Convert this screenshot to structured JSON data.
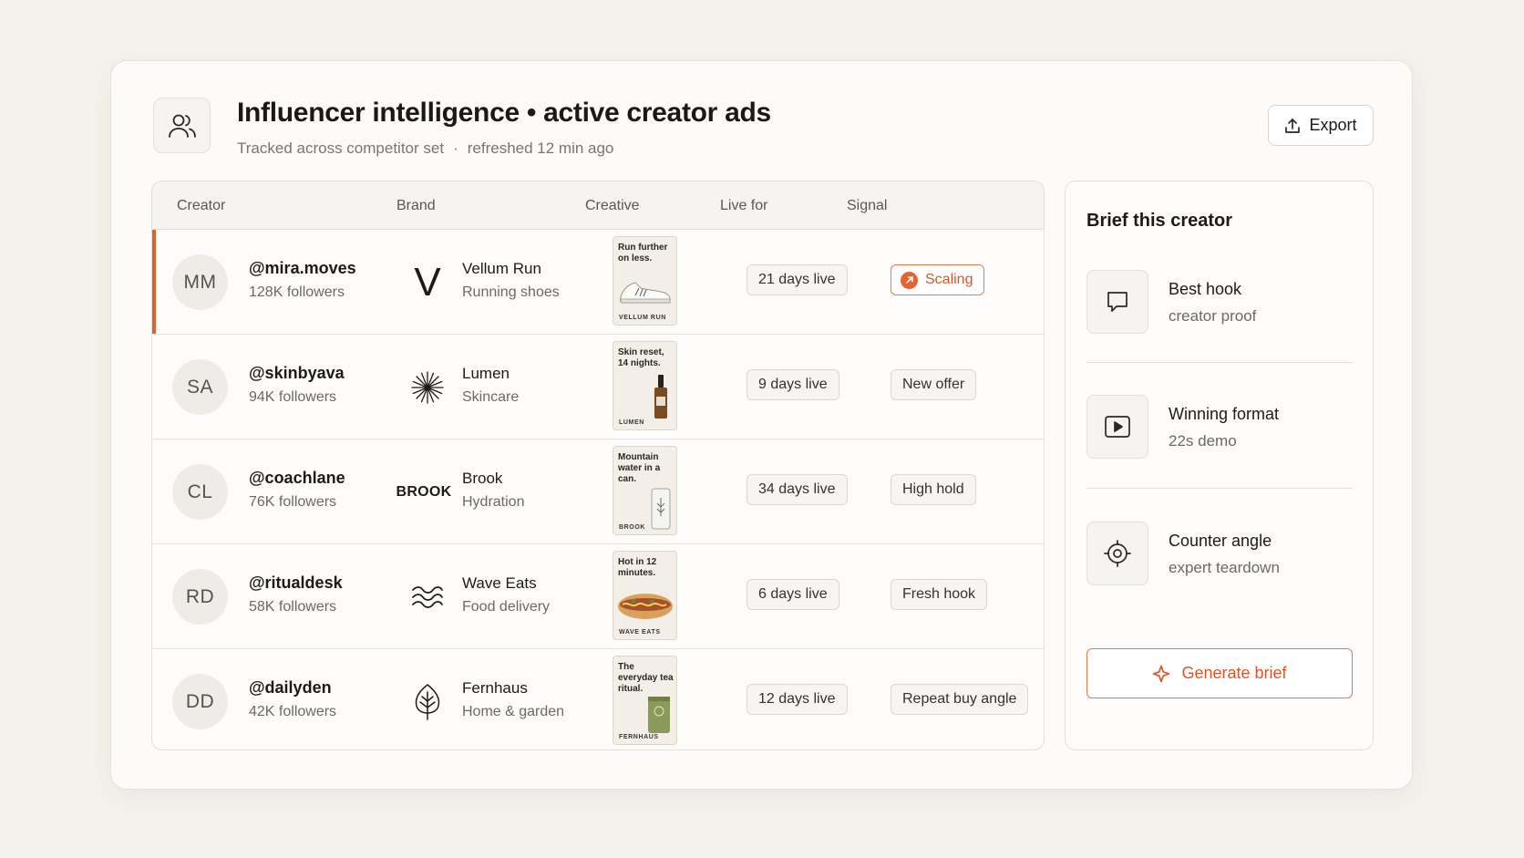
{
  "header": {
    "title": "Influencer intelligence • active creator ads",
    "subtitle_left": "Tracked across competitor set",
    "subtitle_sep": "·",
    "subtitle_right": "refreshed 12 min ago",
    "export_label": "Export",
    "icon": "users-icon"
  },
  "table": {
    "columns": [
      "Creator",
      "Brand",
      "Creative",
      "Live for",
      "Signal"
    ],
    "rows": [
      {
        "initials": "MM",
        "handle": "@mira.moves",
        "followers": "128K followers",
        "brand": "Vellum Run",
        "category": "Running shoes",
        "brand_logo_text": "V",
        "creative_text": "Run further on less.",
        "creative_footer": "VELLUM RUN",
        "live": "21 days live",
        "signal": "Scaling",
        "active": true
      },
      {
        "initials": "SA",
        "handle": "@skinbyava",
        "followers": "94K followers",
        "brand": "Lumen",
        "category": "Skincare",
        "brand_logo_text": "",
        "creative_text": "Skin reset, 14 nights.",
        "creative_footer": "LUMEN",
        "live": "9 days live",
        "signal": "New offer"
      },
      {
        "initials": "CL",
        "handle": "@coachlane",
        "followers": "76K followers",
        "brand": "Brook",
        "category": "Hydration",
        "brand_logo_text": "BROOK",
        "creative_text": "Mountain water in a can.",
        "creative_footer": "BROOK",
        "live": "34 days live",
        "signal": "High hold"
      },
      {
        "initials": "RD",
        "handle": "@ritualdesk",
        "followers": "58K followers",
        "brand": "Wave Eats",
        "category": "Food delivery",
        "brand_logo_text": "",
        "creative_text": "Hot in 12 minutes.",
        "creative_footer": "WAVE EATS",
        "live": "6 days live",
        "signal": "Fresh hook"
      },
      {
        "initials": "DD",
        "handle": "@dailyden",
        "followers": "42K followers",
        "brand": "Fernhaus",
        "category": "Home & garden",
        "brand_logo_text": "",
        "creative_text": "The everyday tea ritual.",
        "creative_footer": "FERNHAUS",
        "live": "12 days live",
        "signal": "Repeat buy angle"
      }
    ]
  },
  "brief": {
    "title": "Brief this creator",
    "items": [
      {
        "label": "Best hook",
        "value": "creator proof",
        "icon": "chat-bubble-icon"
      },
      {
        "label": "Winning format",
        "value": "22s demo",
        "icon": "play-icon"
      },
      {
        "label": "Counter angle",
        "value": "expert teardown",
        "icon": "target-icon"
      }
    ],
    "button_label": "Generate brief"
  },
  "colors": {
    "accent": "#e0602f",
    "background": "#f5f2ec",
    "card": "#fcfbf9"
  }
}
